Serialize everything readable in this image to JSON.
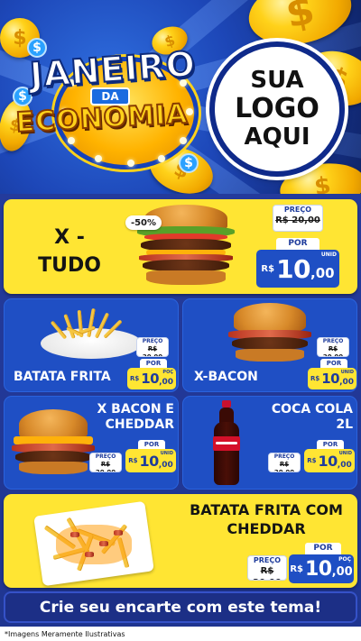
{
  "header": {
    "title_line1": "JANEIRO",
    "title_line2": "DA",
    "title_line3": "ECONOMIA",
    "logo_lines": [
      "SUA",
      "LOGO",
      "AQUI"
    ]
  },
  "products": {
    "featured": {
      "name": "X -\nTUDO",
      "discount": "-50%",
      "preco_label": "PREÇO",
      "old_price": "R$ 20,00",
      "por_label": "POR",
      "currency": "R$",
      "price_int": "10",
      "price_cents": ",00",
      "unit": "UNID"
    },
    "batata_frita": {
      "name": "BATATA FRITA",
      "preco_label": "PREÇO",
      "old_price": "R$ 20,00",
      "por_label": "POR",
      "currency": "R$",
      "price_int": "10",
      "price_cents": ",00",
      "unit": "POÇ"
    },
    "x_bacon": {
      "name": "X-BACON",
      "preco_label": "PREÇO",
      "old_price": "R$ 20,00",
      "por_label": "POR",
      "currency": "R$",
      "price_int": "10",
      "price_cents": ",00",
      "unit": "UNID"
    },
    "x_bacon_cheddar": {
      "name": "X BACON E\nCHEDDAR",
      "preco_label": "PREÇO",
      "old_price": "R$ 20,00",
      "por_label": "POR",
      "currency": "R$",
      "price_int": "10",
      "price_cents": ",00",
      "unit": "UNID"
    },
    "coca_cola": {
      "name": "COCA COLA\n2L",
      "preco_label": "PREÇO",
      "old_price": "R$ 20,00",
      "por_label": "POR",
      "currency": "R$",
      "price_int": "10",
      "price_cents": ",00",
      "unit": "UNID"
    },
    "batata_cheddar": {
      "name": "BATATA FRITA COM\nCHEDDAR",
      "preco_label": "PREÇO",
      "old_price": "R$ 20,00",
      "por_label": "POR",
      "currency": "R$",
      "price_int": "10",
      "price_cents": ",00",
      "unit": "POÇ"
    }
  },
  "cta": {
    "label": "Crie seu encarte com este tema!"
  },
  "footer": {
    "note": "*Imagens Meramente Ilustrativas"
  },
  "colors": {
    "brand_blue": "#1f4fc4",
    "accent_yellow": "#ffe533",
    "dark_navy": "#1c2f86"
  }
}
